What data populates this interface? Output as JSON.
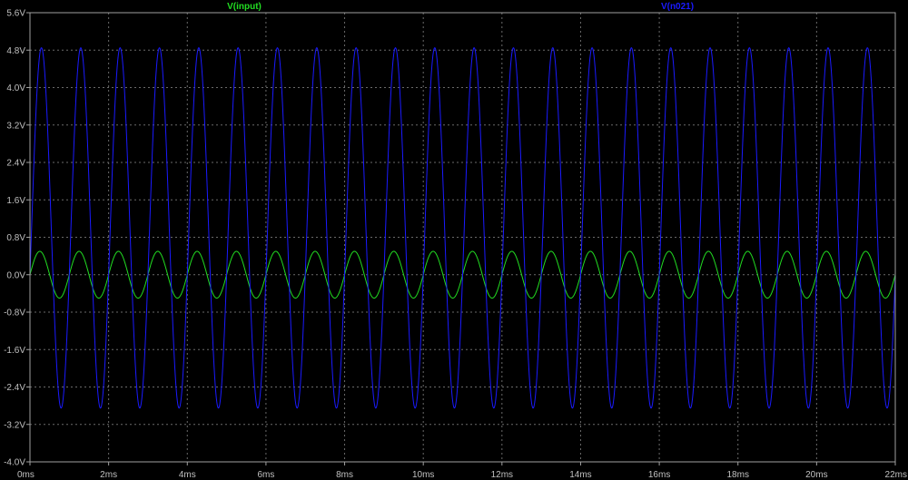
{
  "chart_data": {
    "type": "line",
    "title": "",
    "x_unit": "ms",
    "y_unit": "V",
    "xlim": [
      0,
      22
    ],
    "ylim": [
      -4.0,
      5.6
    ],
    "x_ticks": [
      "0ms",
      "2ms",
      "4ms",
      "6ms",
      "8ms",
      "10ms",
      "12ms",
      "14ms",
      "16ms",
      "18ms",
      "20ms",
      "22ms"
    ],
    "x_tick_values": [
      0,
      2,
      4,
      6,
      8,
      10,
      12,
      14,
      16,
      18,
      20,
      22
    ],
    "y_ticks": [
      "5.6V",
      "4.8V",
      "4.0V",
      "3.2V",
      "2.4V",
      "1.6V",
      "0.8V",
      "0.0V",
      "-0.8V",
      "-1.6V",
      "-2.4V",
      "-3.2V",
      "-4.0V"
    ],
    "y_tick_values": [
      5.6,
      4.8,
      4.0,
      3.2,
      2.4,
      1.6,
      0.8,
      0.0,
      -0.8,
      -1.6,
      -2.4,
      -3.2,
      -4.0
    ],
    "grid": true,
    "series": [
      {
        "name": "V(input)",
        "color": "#22dd22",
        "waveform": "sine",
        "frequency_hz": 1000,
        "offset_v": 0.0,
        "amplitude_v": 0.5,
        "phase_deg": 0
      },
      {
        "name": "V(n021)",
        "color": "#1a1aff",
        "waveform": "sine",
        "frequency_hz": 1000,
        "offset_v": 1.0,
        "amplitude_v": 3.85,
        "phase_deg": -15
      }
    ]
  },
  "colors": {
    "background": "#000000",
    "grid": "#6a6a6a",
    "frame": "#a0a0a0",
    "tick_text": "#c0c0c0"
  }
}
